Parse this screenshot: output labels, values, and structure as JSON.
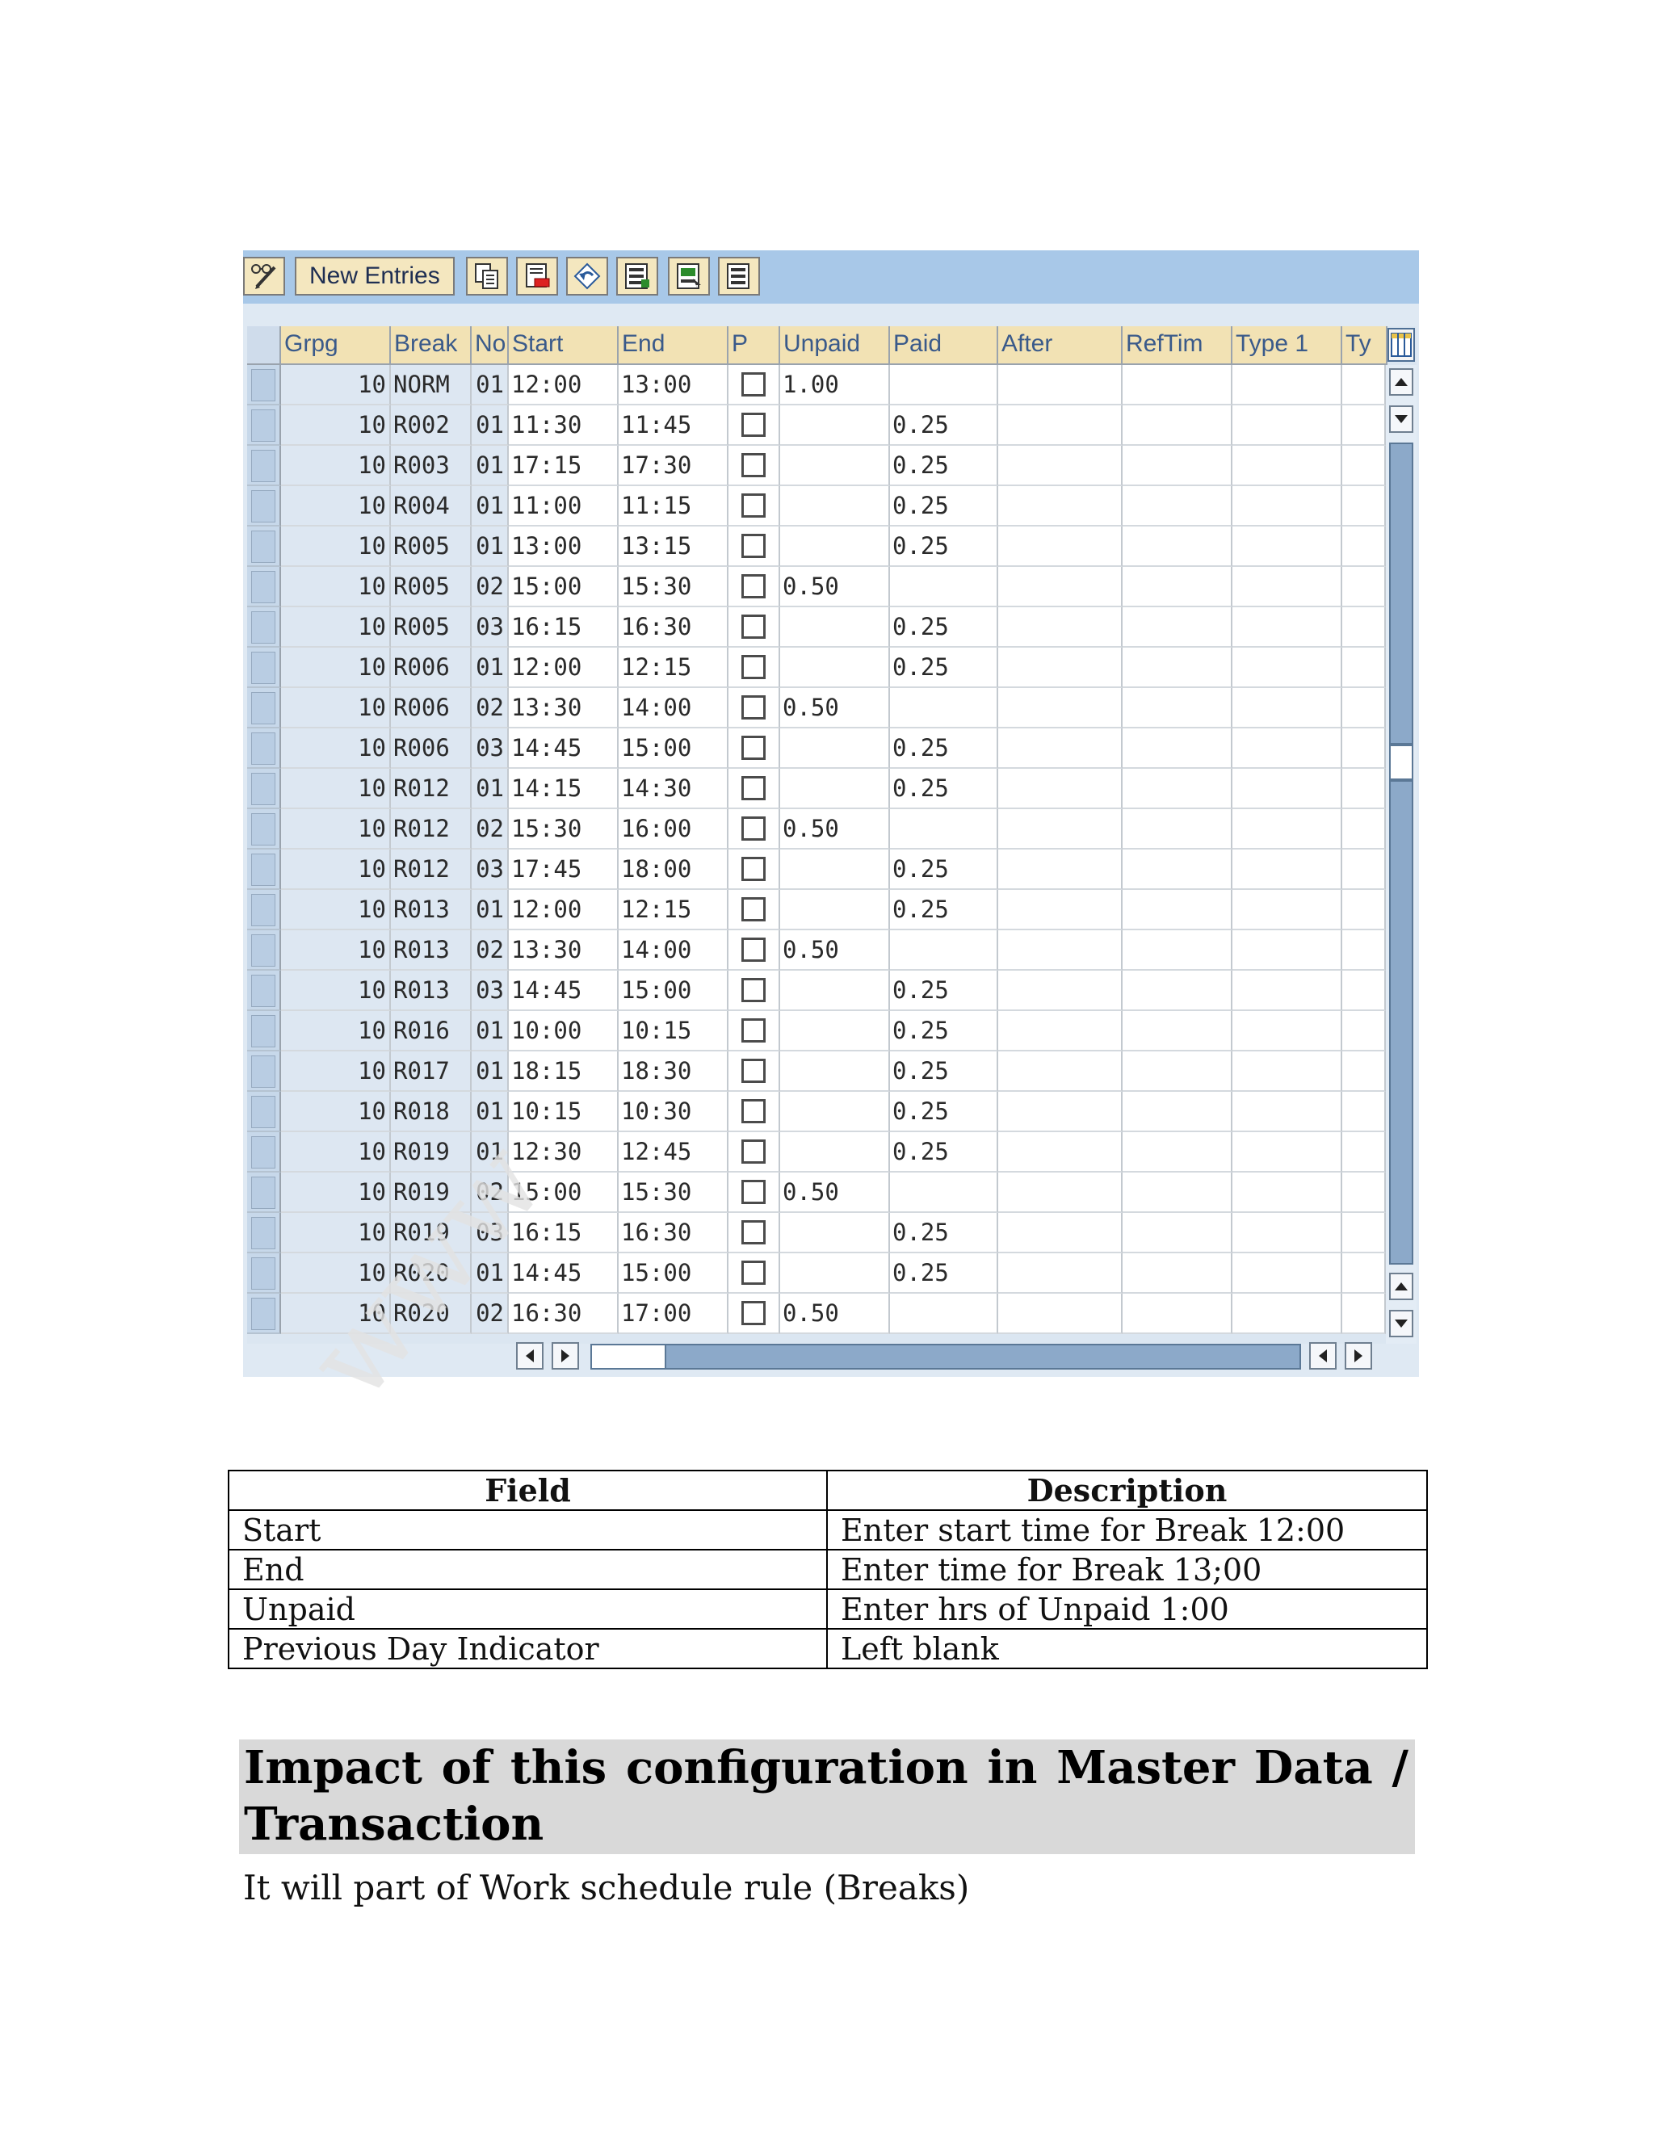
{
  "toolbar": {
    "new_entries_label": "New Entries",
    "icons": [
      "pencil-glasses-icon",
      "copy-icon",
      "delete-icon",
      "undo-icon",
      "select-all-icon",
      "select-block-icon",
      "deselect-all-icon"
    ]
  },
  "grid": {
    "columns": [
      "Grpg",
      "Break",
      "No",
      "Start",
      "End",
      "P",
      "Unpaid",
      "Paid",
      "After",
      "RefTim",
      "Type 1",
      "Ty"
    ],
    "rows": [
      {
        "grpg": "10",
        "brk": "NORM",
        "no": "01",
        "start": "12:00",
        "end": "13:00",
        "p": false,
        "unpaid": "1.00",
        "paid": ""
      },
      {
        "grpg": "10",
        "brk": "R002",
        "no": "01",
        "start": "11:30",
        "end": "11:45",
        "p": false,
        "unpaid": "",
        "paid": "0.25"
      },
      {
        "grpg": "10",
        "brk": "R003",
        "no": "01",
        "start": "17:15",
        "end": "17:30",
        "p": false,
        "unpaid": "",
        "paid": "0.25"
      },
      {
        "grpg": "10",
        "brk": "R004",
        "no": "01",
        "start": "11:00",
        "end": "11:15",
        "p": false,
        "unpaid": "",
        "paid": "0.25"
      },
      {
        "grpg": "10",
        "brk": "R005",
        "no": "01",
        "start": "13:00",
        "end": "13:15",
        "p": false,
        "unpaid": "",
        "paid": "0.25"
      },
      {
        "grpg": "10",
        "brk": "R005",
        "no": "02",
        "start": "15:00",
        "end": "15:30",
        "p": false,
        "unpaid": "0.50",
        "paid": ""
      },
      {
        "grpg": "10",
        "brk": "R005",
        "no": "03",
        "start": "16:15",
        "end": "16:30",
        "p": false,
        "unpaid": "",
        "paid": "0.25"
      },
      {
        "grpg": "10",
        "brk": "R006",
        "no": "01",
        "start": "12:00",
        "end": "12:15",
        "p": false,
        "unpaid": "",
        "paid": "0.25"
      },
      {
        "grpg": "10",
        "brk": "R006",
        "no": "02",
        "start": "13:30",
        "end": "14:00",
        "p": false,
        "unpaid": "0.50",
        "paid": ""
      },
      {
        "grpg": "10",
        "brk": "R006",
        "no": "03",
        "start": "14:45",
        "end": "15:00",
        "p": false,
        "unpaid": "",
        "paid": "0.25"
      },
      {
        "grpg": "10",
        "brk": "R012",
        "no": "01",
        "start": "14:15",
        "end": "14:30",
        "p": false,
        "unpaid": "",
        "paid": "0.25"
      },
      {
        "grpg": "10",
        "brk": "R012",
        "no": "02",
        "start": "15:30",
        "end": "16:00",
        "p": false,
        "unpaid": "0.50",
        "paid": ""
      },
      {
        "grpg": "10",
        "brk": "R012",
        "no": "03",
        "start": "17:45",
        "end": "18:00",
        "p": false,
        "unpaid": "",
        "paid": "0.25"
      },
      {
        "grpg": "10",
        "brk": "R013",
        "no": "01",
        "start": "12:00",
        "end": "12:15",
        "p": false,
        "unpaid": "",
        "paid": "0.25"
      },
      {
        "grpg": "10",
        "brk": "R013",
        "no": "02",
        "start": "13:30",
        "end": "14:00",
        "p": false,
        "unpaid": "0.50",
        "paid": ""
      },
      {
        "grpg": "10",
        "brk": "R013",
        "no": "03",
        "start": "14:45",
        "end": "15:00",
        "p": false,
        "unpaid": "",
        "paid": "0.25"
      },
      {
        "grpg": "10",
        "brk": "R016",
        "no": "01",
        "start": "10:00",
        "end": "10:15",
        "p": false,
        "unpaid": "",
        "paid": "0.25"
      },
      {
        "grpg": "10",
        "brk": "R017",
        "no": "01",
        "start": "18:15",
        "end": "18:30",
        "p": false,
        "unpaid": "",
        "paid": "0.25"
      },
      {
        "grpg": "10",
        "brk": "R018",
        "no": "01",
        "start": "10:15",
        "end": "10:30",
        "p": false,
        "unpaid": "",
        "paid": "0.25"
      },
      {
        "grpg": "10",
        "brk": "R019",
        "no": "01",
        "start": "12:30",
        "end": "12:45",
        "p": false,
        "unpaid": "",
        "paid": "0.25"
      },
      {
        "grpg": "10",
        "brk": "R019",
        "no": "02",
        "start": "15:00",
        "end": "15:30",
        "p": false,
        "unpaid": "0.50",
        "paid": ""
      },
      {
        "grpg": "10",
        "brk": "R019",
        "no": "03",
        "start": "16:15",
        "end": "16:30",
        "p": false,
        "unpaid": "",
        "paid": "0.25"
      },
      {
        "grpg": "10",
        "brk": "R020",
        "no": "01",
        "start": "14:45",
        "end": "15:00",
        "p": false,
        "unpaid": "",
        "paid": "0.25"
      },
      {
        "grpg": "10",
        "brk": "R020",
        "no": "02",
        "start": "16:30",
        "end": "17:00",
        "p": false,
        "unpaid": "0.50",
        "paid": ""
      }
    ]
  },
  "field_table": {
    "headers": [
      "Field",
      "Description"
    ],
    "rows": [
      {
        "field": "Start",
        "description": "Enter  start time for Break 12:00"
      },
      {
        "field": "End",
        "description": "Enter  time  for Break   13;00"
      },
      {
        "field": "Unpaid",
        "description": "Enter hrs of Unpaid    1:00"
      },
      {
        "field": "Previous Day Indicator",
        "description": "Left blank"
      }
    ]
  },
  "heading": "Impact of this configuration in Master Data / Transaction",
  "body_text": "It will part of Work schedule rule (Breaks)",
  "colors": {
    "toolbar_bg": "#a8c8e8",
    "header_bg": "#f2e2b4",
    "key_cell_bg": "#dde7f2",
    "heading_bg": "#d9d9d9"
  }
}
